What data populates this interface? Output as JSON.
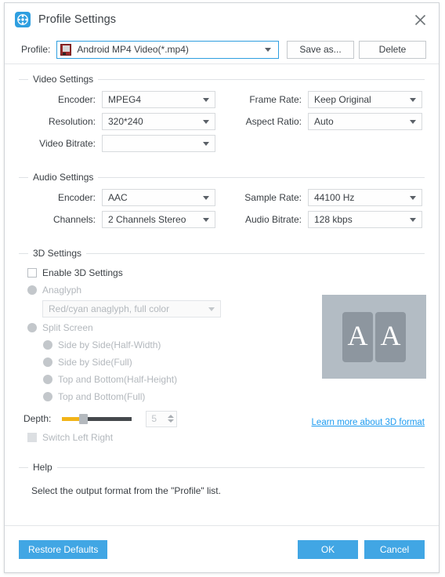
{
  "window": {
    "title": "Profile Settings",
    "icon": "film-reel-icon",
    "close_label": "✕"
  },
  "profile_bar": {
    "label": "Profile:",
    "value": "Android MP4 Video(*.mp4)",
    "save_as_label": "Save as...",
    "delete_label": "Delete"
  },
  "video_settings": {
    "title": "Video Settings",
    "fields": [
      {
        "label": "Encoder:",
        "value": "MPEG4"
      },
      {
        "label": "Resolution:",
        "value": "320*240"
      },
      {
        "label": "Video Bitrate:",
        "value": ""
      },
      {
        "label": "Frame Rate:",
        "value": "Keep Original"
      },
      {
        "label": "Aspect Ratio:",
        "value": "Auto"
      }
    ]
  },
  "audio_settings": {
    "title": "Audio Settings",
    "fields": [
      {
        "label": "Encoder:",
        "value": "AAC"
      },
      {
        "label": "Channels:",
        "value": "2 Channels Stereo"
      },
      {
        "label": "Sample Rate:",
        "value": "44100 Hz"
      },
      {
        "label": "Audio Bitrate:",
        "value": "128 kbps"
      }
    ]
  },
  "three_d_settings": {
    "title": "3D Settings",
    "enable_label": "Enable 3D Settings",
    "enable_checked": false,
    "anaglyph_label": "Anaglyph",
    "anaglyph_value": "Red/cyan anaglyph, full color",
    "split_screen_label": "Split Screen",
    "split_options": [
      "Side by Side(Half-Width)",
      "Side by Side(Full)",
      "Top and Bottom(Half-Height)",
      "Top and Bottom(Full)"
    ],
    "depth_label": "Depth:",
    "depth_value": "5",
    "switch_left_right_label": "Switch Left Right",
    "learn_more_label": "Learn more about 3D format",
    "preview_letters": [
      "A",
      "A"
    ]
  },
  "help": {
    "title": "Help",
    "text": "Select the output format from the \"Profile\" list."
  },
  "footer": {
    "restore_defaults_label": "Restore Defaults",
    "ok_label": "OK",
    "cancel_label": "Cancel"
  },
  "colors": {
    "accent": "#41a6e4",
    "link": "#1d9bf0",
    "slider_fill": "#f2b418",
    "preview_bg": "#b3bcc4"
  }
}
